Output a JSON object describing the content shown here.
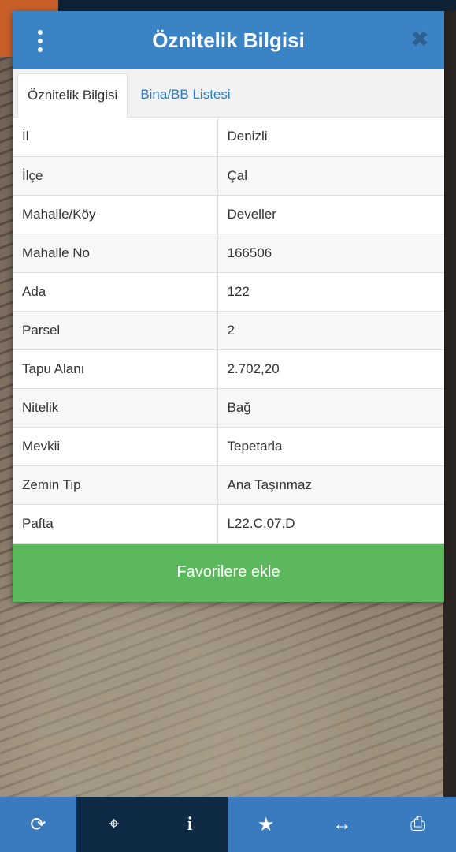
{
  "dialog": {
    "title": "Öznitelik Bilgisi",
    "menu_icon": "vertical-dots-icon",
    "close_icon": "close-icon",
    "tabs": [
      {
        "label": "Öznitelik Bilgisi",
        "active": true
      },
      {
        "label": "Bina/BB Listesi",
        "active": false
      }
    ],
    "rows": [
      {
        "key": "İl",
        "value": "Denizli"
      },
      {
        "key": "İlçe",
        "value": "Çal"
      },
      {
        "key": "Mahalle/Köy",
        "value": "Develler"
      },
      {
        "key": "Mahalle No",
        "value": "166506"
      },
      {
        "key": "Ada",
        "value": "122"
      },
      {
        "key": "Parsel",
        "value": "2"
      },
      {
        "key": "Tapu Alanı",
        "value": "2.702,20"
      },
      {
        "key": "Nitelik",
        "value": "Bağ"
      },
      {
        "key": "Mevkii",
        "value": "Tepetarla"
      },
      {
        "key": "Zemin Tip",
        "value": "Ana Taşınmaz"
      },
      {
        "key": "Pafta",
        "value": "L22.C.07.D"
      }
    ],
    "favorite_button": "Favorilere ekle"
  },
  "toolbar": {
    "buttons": [
      {
        "icon": "refresh-icon",
        "glyph": "⟳"
      },
      {
        "icon": "crosshair-icon",
        "glyph": "⌖"
      },
      {
        "icon": "info-icon",
        "glyph": "i"
      },
      {
        "icon": "star-icon",
        "glyph": "★"
      },
      {
        "icon": "measure-arrows-icon",
        "glyph": "↔"
      },
      {
        "icon": "print-icon",
        "glyph": "⎙"
      }
    ]
  },
  "colors": {
    "header": "#3a83c4",
    "tab_link": "#2f7abf",
    "favorite_button": "#5cb85c",
    "toolbar": "#3a7bbf",
    "toolbar_active": "#0f2a45"
  }
}
